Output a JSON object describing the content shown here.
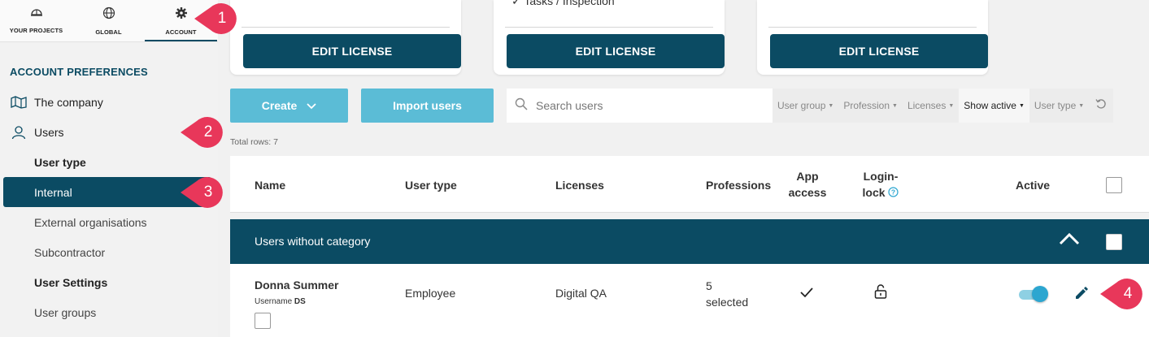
{
  "topnav": {
    "tabs": [
      {
        "label": "YOUR PROJECTS",
        "icon": "helmet-icon"
      },
      {
        "label": "GLOBAL",
        "icon": "globe-icon"
      },
      {
        "label": "ACCOUNT",
        "icon": "gear-icon"
      }
    ]
  },
  "sidebar": {
    "section_title": "ACCOUNT PREFERENCES",
    "items": {
      "company": "The company",
      "users": "Users",
      "user_type": "User type",
      "internal": "Internal",
      "external": "External organisations",
      "subcontractor": "Subcontractor",
      "user_settings": "User Settings",
      "user_groups": "User groups"
    }
  },
  "cards": {
    "partial_text": "Tasks / Inspection",
    "edit_label": "EDIT LICENSE"
  },
  "toolbar": {
    "create_label": "Create",
    "import_label": "Import users",
    "search_placeholder": "Search users",
    "filters": {
      "user_group": "User group",
      "profession": "Profession",
      "licenses": "Licenses",
      "show_active": "Show active",
      "user_type": "User type"
    }
  },
  "table": {
    "total_rows": "Total rows: 7",
    "headers": {
      "name": "Name",
      "user_type": "User type",
      "licenses": "Licenses",
      "professions": "Professions",
      "app_access_1": "App",
      "app_access_2": "access",
      "login_lock_1": "Login-",
      "login_lock_2": "lock",
      "active": "Active"
    },
    "group_label": "Users without category",
    "row": {
      "name": "Donna Summer",
      "username_label": "Username",
      "username": "DS",
      "user_type": "Employee",
      "license": "Digital QA",
      "professions_count": "5",
      "professions_suffix": "selected",
      "active": true
    }
  },
  "annotations": {
    "badge1": "1",
    "badge2": "2",
    "badge3": "3",
    "badge4": "4",
    "color": "#e8375a"
  },
  "colors": {
    "primary": "#0b4b63",
    "accent": "#5bbcd6"
  }
}
